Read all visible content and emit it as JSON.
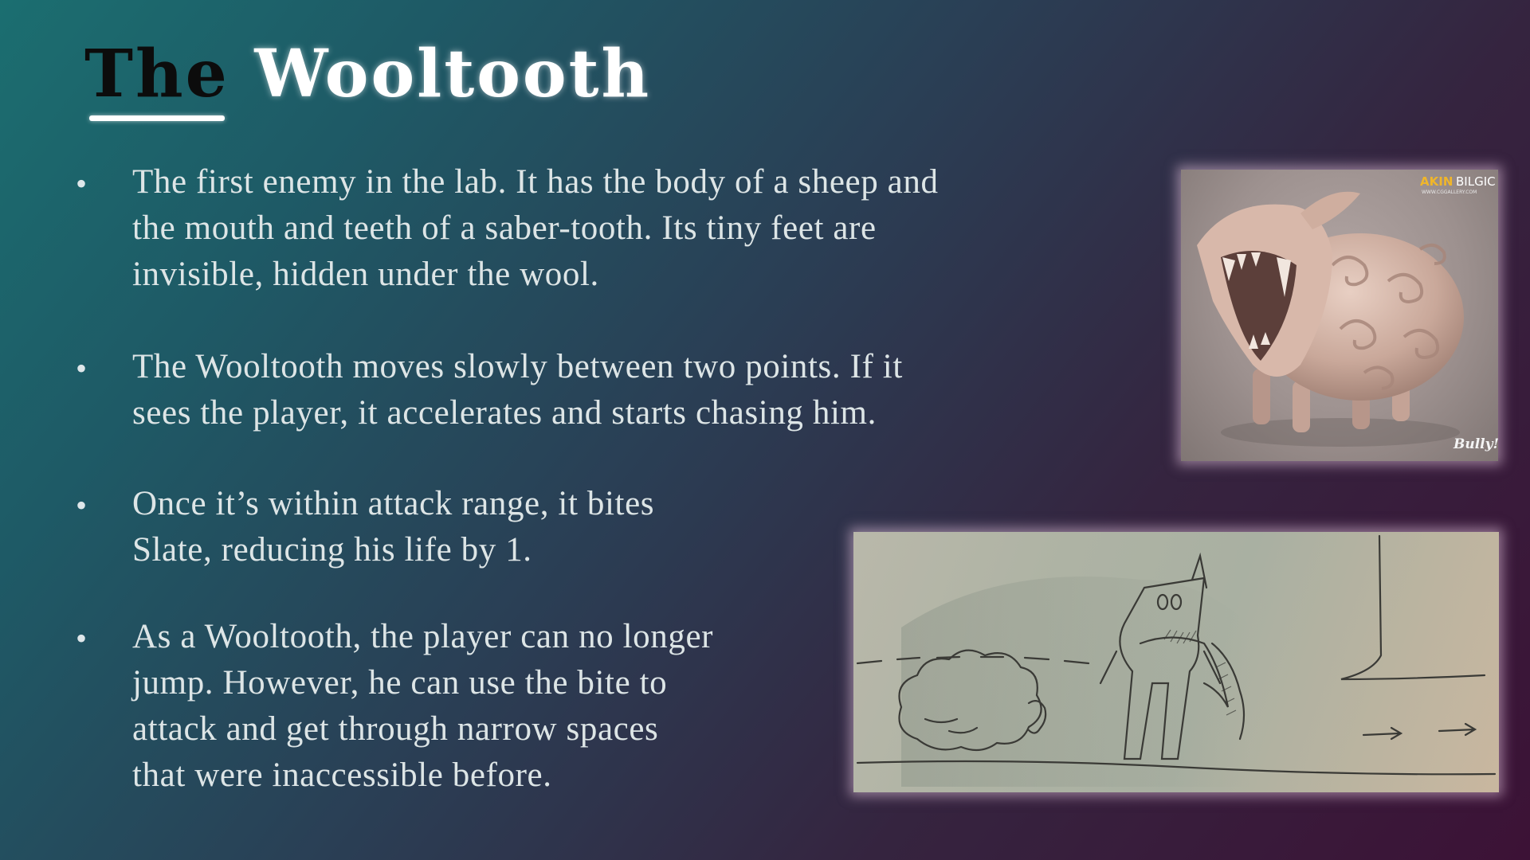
{
  "slide": {
    "title_part1": "The",
    "title_part2": "Wooltooth",
    "bullet_glyph": "•",
    "bullets": [
      {
        "lines": [
          "The first enemy in the lab. It has the body of a sheep and",
          "the mouth and teeth of a saber-tooth. Its tiny feet are",
          "invisible, hidden under the wool."
        ]
      },
      {
        "lines": [
          "The Wooltooth moves slowly between two points. If it",
          "sees the player, it accelerates and starts chasing him."
        ]
      },
      {
        "lines": [
          "Once it’s within attack range, it bites",
          "Slate, reducing his life by 1."
        ]
      },
      {
        "lines": [
          "As a Wooltooth, the player can no longer",
          "jump. However, he can use the bite to",
          "attack and get through narrow spaces",
          "that were inaccessible before."
        ]
      }
    ]
  },
  "images": {
    "render": {
      "watermark_brand_a": "AKIN",
      "watermark_brand_b": "BILGIC",
      "watermark_site": "WWW.CGGALLERY.COM",
      "studio_logo": "Bully!"
    },
    "sketch": {
      "arrow_icon": "arrow-right-icon"
    }
  },
  "colors": {
    "title_dark": "#0c0c0c",
    "title_light": "#ffffff",
    "body_text": "#dde5e6",
    "bg_start": "#1b6e70",
    "bg_end": "#3c1236"
  }
}
